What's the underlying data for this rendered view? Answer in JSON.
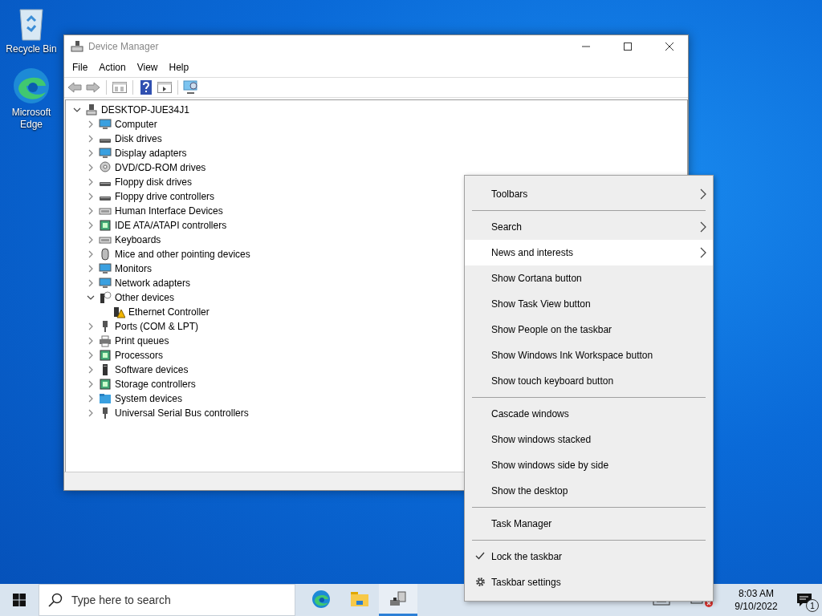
{
  "desktop_icons": [
    {
      "label": "Recycle Bin"
    },
    {
      "label": "Microsoft Edge"
    }
  ],
  "window": {
    "title": "Device Manager",
    "menu": [
      "File",
      "Action",
      "View",
      "Help"
    ],
    "tree": {
      "label": "DESKTOP-JUE34J1",
      "expanded": true,
      "children": [
        {
          "label": "Computer",
          "expanded": false
        },
        {
          "label": "Disk drives",
          "expanded": false
        },
        {
          "label": "Display adapters",
          "expanded": false
        },
        {
          "label": "DVD/CD-ROM drives",
          "expanded": false
        },
        {
          "label": "Floppy disk drives",
          "expanded": false
        },
        {
          "label": "Floppy drive controllers",
          "expanded": false
        },
        {
          "label": "Human Interface Devices",
          "expanded": false
        },
        {
          "label": "IDE ATA/ATAPI controllers",
          "expanded": false
        },
        {
          "label": "Keyboards",
          "expanded": false
        },
        {
          "label": "Mice and other pointing devices",
          "expanded": false
        },
        {
          "label": "Monitors",
          "expanded": false
        },
        {
          "label": "Network adapters",
          "expanded": false
        },
        {
          "label": "Other devices",
          "expanded": true,
          "children": [
            {
              "label": "Ethernet Controller"
            }
          ]
        },
        {
          "label": "Ports (COM & LPT)",
          "expanded": false
        },
        {
          "label": "Print queues",
          "expanded": false
        },
        {
          "label": "Processors",
          "expanded": false
        },
        {
          "label": "Software devices",
          "expanded": false
        },
        {
          "label": "Storage controllers",
          "expanded": false
        },
        {
          "label": "System devices",
          "expanded": false
        },
        {
          "label": "Universal Serial Bus controllers",
          "expanded": false
        }
      ]
    }
  },
  "context_menu": {
    "items": [
      {
        "kind": "item",
        "label": "Toolbars",
        "submenu": true,
        "checked": false,
        "selected": false
      },
      {
        "kind": "separator"
      },
      {
        "kind": "item",
        "label": "Search",
        "submenu": true,
        "checked": false,
        "selected": false
      },
      {
        "kind": "item",
        "label": "News and interests",
        "submenu": true,
        "checked": false,
        "selected": true
      },
      {
        "kind": "item",
        "label": "Show Cortana button",
        "submenu": false,
        "checked": false,
        "selected": false
      },
      {
        "kind": "item",
        "label": "Show Task View button",
        "submenu": false,
        "checked": false,
        "selected": false
      },
      {
        "kind": "item",
        "label": "Show People on the taskbar",
        "submenu": false,
        "checked": false,
        "selected": false
      },
      {
        "kind": "item",
        "label": "Show Windows Ink Workspace button",
        "submenu": false,
        "checked": false,
        "selected": false
      },
      {
        "kind": "item",
        "label": "Show touch keyboard button",
        "submenu": false,
        "checked": false,
        "selected": false
      },
      {
        "kind": "separator"
      },
      {
        "kind": "item",
        "label": "Cascade windows",
        "submenu": false,
        "checked": false,
        "selected": false
      },
      {
        "kind": "item",
        "label": "Show windows stacked",
        "submenu": false,
        "checked": false,
        "selected": false
      },
      {
        "kind": "item",
        "label": "Show windows side by side",
        "submenu": false,
        "checked": false,
        "selected": false
      },
      {
        "kind": "item",
        "label": "Show the desktop",
        "submenu": false,
        "checked": false,
        "selected": false
      },
      {
        "kind": "separator"
      },
      {
        "kind": "item",
        "label": "Task Manager",
        "submenu": false,
        "checked": false,
        "selected": false
      },
      {
        "kind": "separator"
      },
      {
        "kind": "item",
        "label": "Lock the taskbar",
        "submenu": false,
        "checked": true,
        "selected": false
      },
      {
        "kind": "settings",
        "label": "Taskbar settings",
        "submenu": false,
        "checked": false,
        "selected": false
      }
    ]
  },
  "taskbar": {
    "search": {
      "placeholder": "Type here to search"
    },
    "apps": [
      {
        "selected": false
      },
      {
        "selected": false
      },
      {
        "selected": true
      }
    ],
    "clock": {
      "time": "8:03 AM",
      "date": "9/10/2022"
    },
    "notifications": {
      "count": "1"
    }
  }
}
